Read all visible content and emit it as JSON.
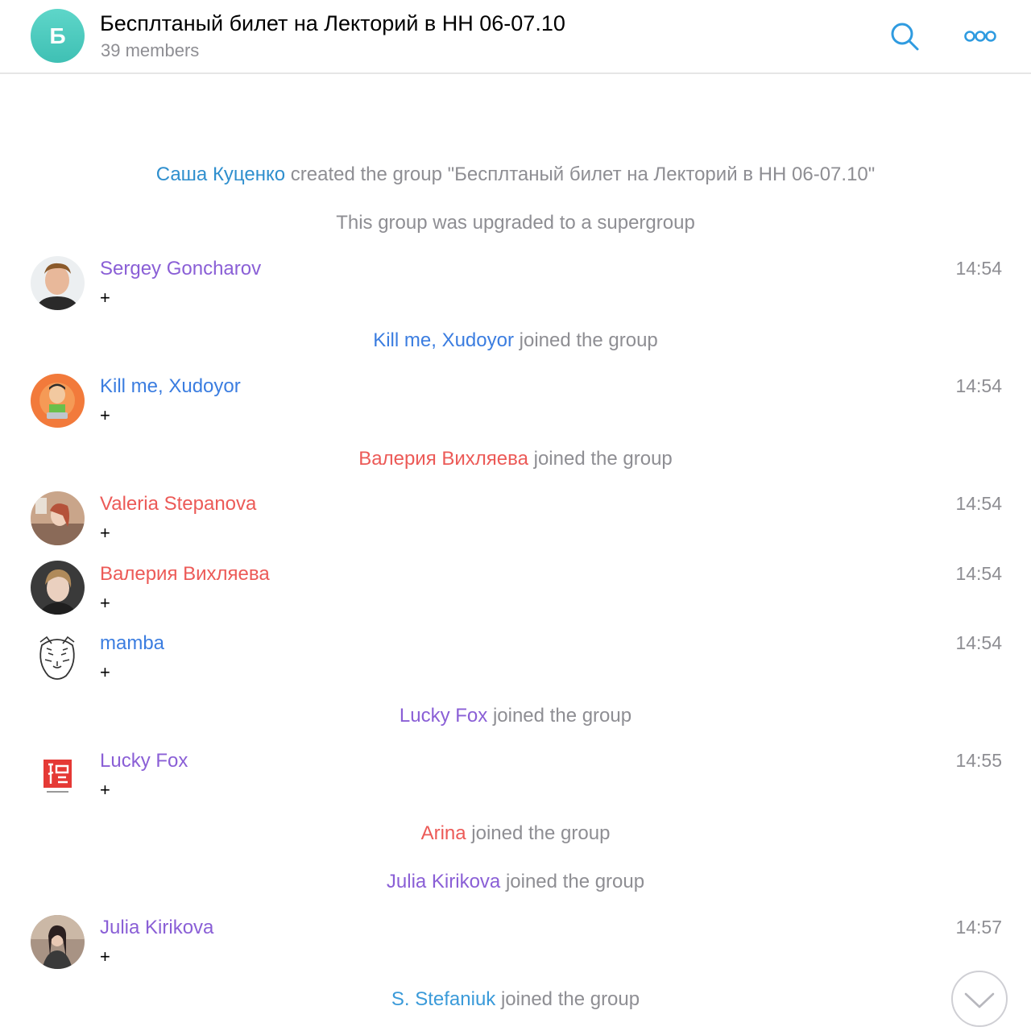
{
  "header": {
    "avatar_letter": "Б",
    "title": "Бесплтаный билет на Лекторий в НН 06-07.10",
    "subtitle": "39 members"
  },
  "service_messages": [
    {
      "who": "Саша Куценко",
      "rest": " created the group \"Бесплтаный билет на Лекторий в НН 06-07.10\"",
      "who_color": "#2f8fce"
    },
    {
      "who": "",
      "rest": "This group was upgraded to a supergroup",
      "who_color": "#8e8e93"
    },
    {
      "who": "Kill me, Xudoyor",
      "rest": " joined the group",
      "who_color": "#3b7de0"
    },
    {
      "who": "Валерия Вихляева",
      "rest": " joined the group",
      "who_color": "#ec5a57"
    },
    {
      "who": "Lucky Fox",
      "rest": " joined the group",
      "who_color": "#8a5fd6"
    },
    {
      "who": "Arina",
      "rest": " joined the group",
      "who_color": "#ec5a57"
    },
    {
      "who": "Julia Kirikova",
      "rest": " joined the group",
      "who_color": "#8a5fd6"
    },
    {
      "who": "S. Stefaniuk",
      "rest": " joined the group",
      "who_color": "#3a9ad9"
    }
  ],
  "messages": [
    {
      "author": "Sergey Goncharov",
      "text": "+",
      "time": "14:54",
      "color": "#8a5fd6",
      "avatar": "photo-man"
    },
    {
      "author": "Kill me, Xudoyor",
      "text": "+",
      "time": "14:54",
      "color": "#3b7de0",
      "avatar": "cartoon"
    },
    {
      "author": "Valeria Stepanova",
      "text": "+",
      "time": "14:54",
      "color": "#ec5a57",
      "avatar": "photo-woman"
    },
    {
      "author": "Валерия Вихляева",
      "text": "+",
      "time": "14:54",
      "color": "#ec5a57",
      "avatar": "photo-woman-2"
    },
    {
      "author": "mamba",
      "text": "+",
      "time": "14:54",
      "color": "#3b7de0",
      "avatar": "tiger-sketch"
    },
    {
      "author": "Lucky Fox",
      "text": "+",
      "time": "14:55",
      "color": "#8a5fd6",
      "avatar": "lucky-fox-logo"
    },
    {
      "author": "Julia Kirikova",
      "text": "+",
      "time": "14:57",
      "color": "#8a5fd6",
      "avatar": "photo-woman-3"
    }
  ],
  "colors": {
    "accent": "#2f9be0",
    "separator": "#e6e6e6",
    "meta": "#8e8e93"
  }
}
